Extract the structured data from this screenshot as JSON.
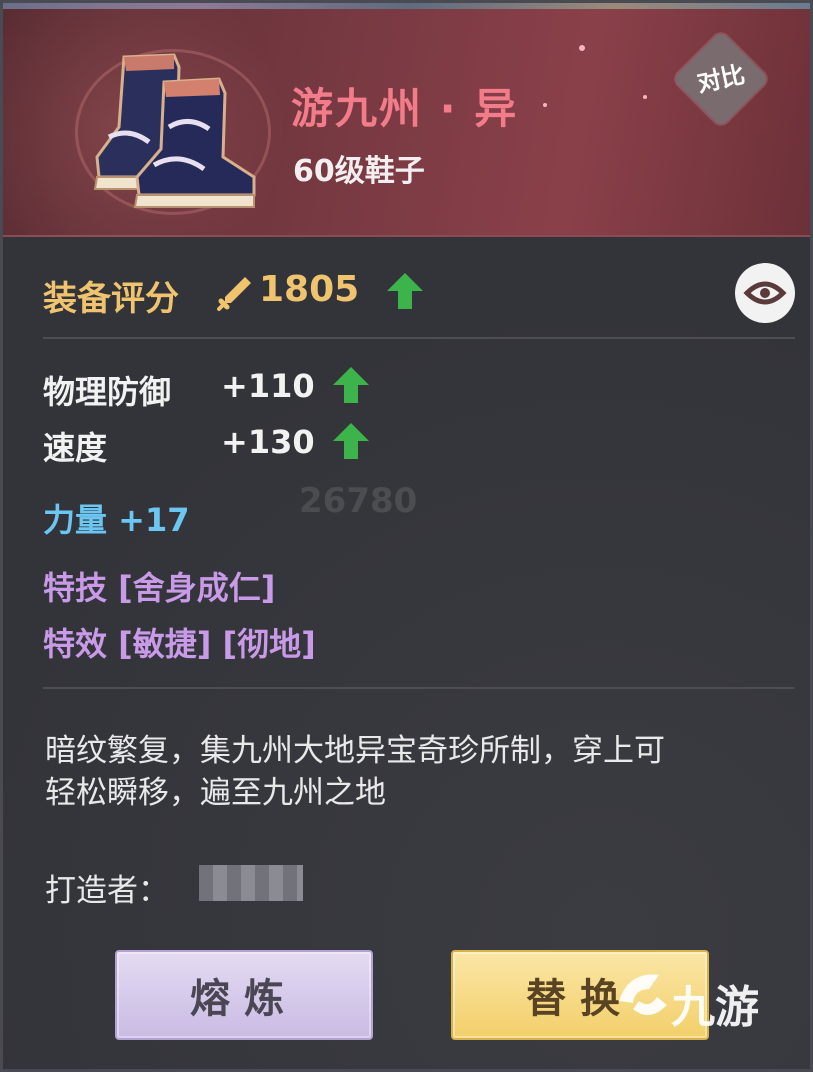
{
  "header": {
    "item_name": "游九州 · 异",
    "item_level": "60级鞋子",
    "compare_label": "对比"
  },
  "score": {
    "label": "装备评分",
    "value": "1805",
    "trend": "up"
  },
  "attributes": [
    {
      "name": "物理防御",
      "value": "+110",
      "trend": "up"
    },
    {
      "name": "速度",
      "value": "+130",
      "trend": "up"
    }
  ],
  "bonus": {
    "label": "力量 +17"
  },
  "skills": [
    {
      "text": "特技 [舍身成仁]"
    },
    {
      "text": "特效 [敏捷] [彻地]"
    }
  ],
  "description": {
    "line1": "暗纹繁复，集九州大地异宝奇珍所制，穿上可",
    "line2": "轻松瞬移，遍至九州之地"
  },
  "maker": {
    "label": "打造者："
  },
  "buttons": {
    "smelt": "熔炼",
    "replace": "替换"
  },
  "watermark": {
    "text": "九游"
  },
  "background_ghost": {
    "score": "26780"
  },
  "colors": {
    "item_name": "#f27c8a",
    "score": "#f0c46e",
    "strength": "#6cc6f2",
    "skill": "#c89ae8",
    "arrow": "#3cb44b"
  },
  "icons": [
    "item-boots-icon",
    "sword-icon",
    "up-arrow-icon",
    "eye-icon",
    "watermark-logo-icon"
  ]
}
